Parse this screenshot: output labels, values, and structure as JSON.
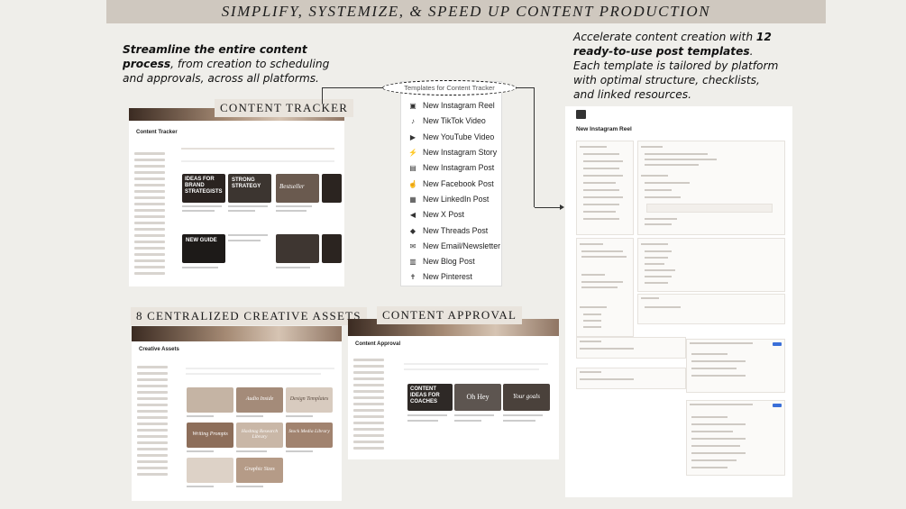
{
  "banner": {
    "title": "SIMPLIFY, SYSTEMIZE, & SPEED UP CONTENT PRODUCTION"
  },
  "intro_left": {
    "bold1": "Streamline the entire content process",
    "rest": ", from creation to scheduling and approvals, across all platforms."
  },
  "intro_right": {
    "lead": "Accelerate content creation with",
    "bold": "12 ready-to-use post templates",
    "rest": ". Each template is tailored by platform with optimal structure, checklists, and linked resources."
  },
  "tracker": {
    "tag": "CONTENT TRACKER",
    "page_title": "Content Tracker",
    "tile_texts": [
      "IDEAS FOR BRAND STRATEGISTS",
      "STRONG STRATEGY",
      "Bestseller",
      "NEW GUIDE"
    ]
  },
  "assets": {
    "tag": "8 CENTRALIZED CREATIVE ASSETS",
    "page_title": "Creative Assets",
    "tiles": [
      "Audio Inside",
      "Design Templates",
      "Writing Prompts",
      "Hashtag Research Library",
      "Stock Media Library",
      "Graphic Sizes"
    ]
  },
  "approval": {
    "tag": "CONTENT APPROVAL",
    "page_title": "Content Approval",
    "tiles": [
      "CONTENT IDEAS FOR COACHES",
      "Oh Hey",
      "Your goals"
    ]
  },
  "dropdown": {
    "header": "Templates for Content Tracker",
    "items": [
      {
        "label": "New Instagram Reel",
        "icon": "film-icon"
      },
      {
        "label": "New TikTok Video",
        "icon": "music-note-icon"
      },
      {
        "label": "New YouTube Video",
        "icon": "play-icon"
      },
      {
        "label": "New Instagram Story",
        "icon": "bolt-icon"
      },
      {
        "label": "New Instagram Post",
        "icon": "image-icon"
      },
      {
        "label": "New Facebook Post",
        "icon": "thumbs-up-icon"
      },
      {
        "label": "New LinkedIn Post",
        "icon": "briefcase-icon"
      },
      {
        "label": "New X Post",
        "icon": "megaphone-icon"
      },
      {
        "label": "New Threads Post",
        "icon": "tag-icon"
      },
      {
        "label": "New Email/Newsletter",
        "icon": "mail-icon"
      },
      {
        "label": "New Blog Post",
        "icon": "book-icon"
      },
      {
        "label": "New Pinterest",
        "icon": "pin-icon"
      }
    ]
  },
  "template_page": {
    "title": "New Instagram Reel"
  },
  "colors": {
    "banner": "#cfc8bf",
    "accent_brown": "#8f7563",
    "dark_brown": "#3b2b22"
  }
}
